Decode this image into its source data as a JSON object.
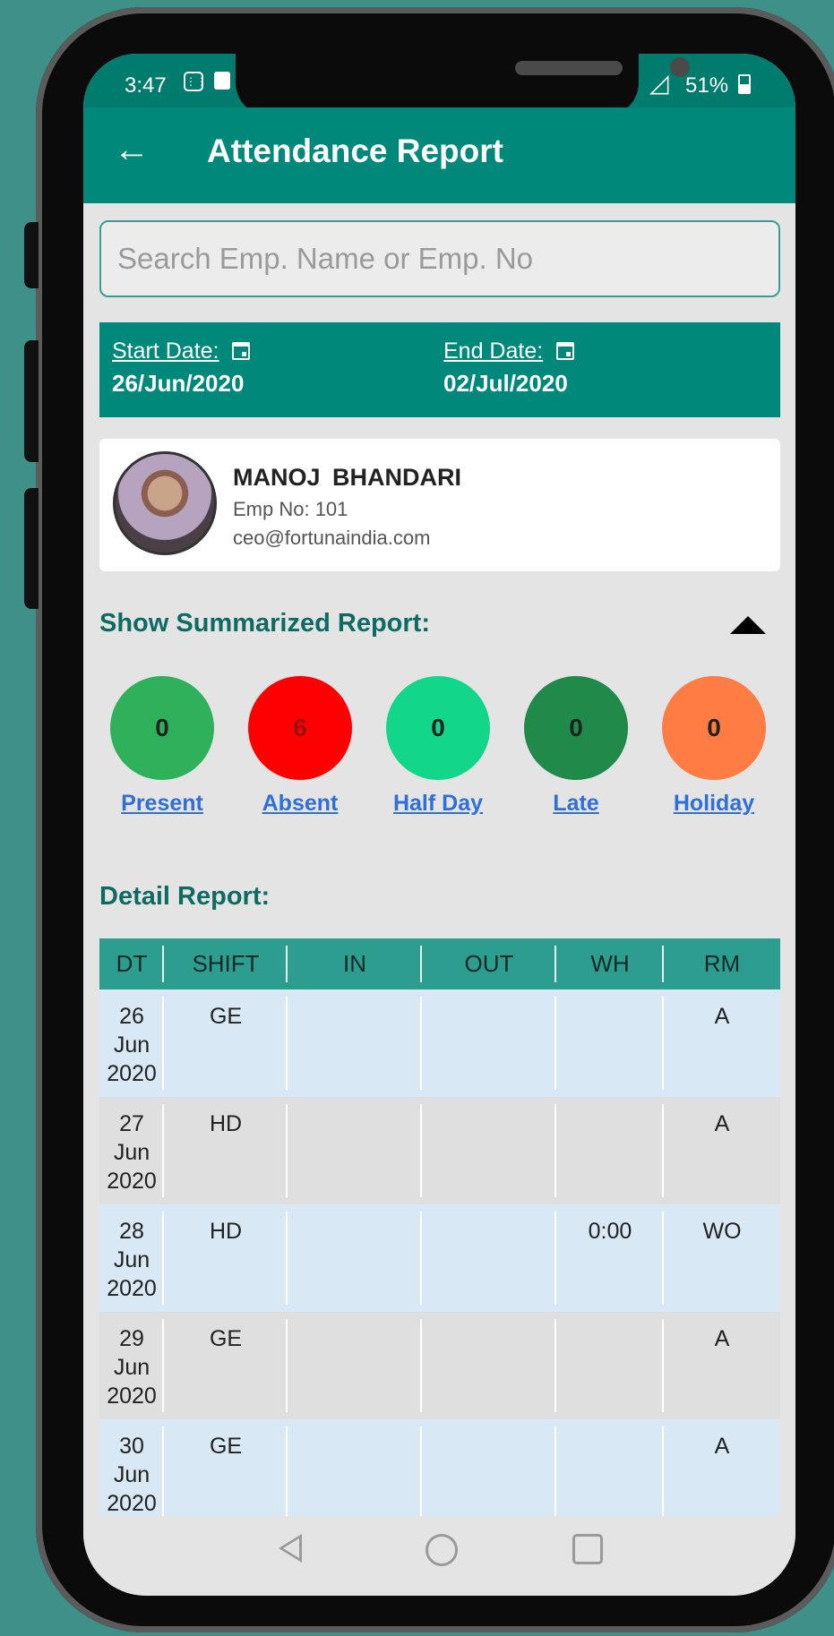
{
  "status": {
    "time": "3:47",
    "battery": "51%",
    "signal_icon": "signal-icon"
  },
  "appbar": {
    "back_icon": "arrow-left-icon",
    "title": "Attendance Report"
  },
  "search": {
    "placeholder": "Search Emp. Name or Emp. No",
    "value": ""
  },
  "dates": {
    "start_label": "Start Date:",
    "start_value": "26/Jun/2020",
    "end_label": "End Date:",
    "end_value": "02/Jul/2020",
    "icon": "calendar-icon"
  },
  "employee": {
    "name": "MANOJ BHANDARI",
    "emp_no": "Emp No: 101",
    "email": "ceo@fortunaindia.com"
  },
  "summary": {
    "title": "Show Summarized Report:",
    "items": [
      {
        "count": "0",
        "label": "Present",
        "color": "#2fb15c",
        "text_color": "#222222"
      },
      {
        "count": "6",
        "label": "Absent",
        "color": "#ff0000",
        "text_color": "#9c1010"
      },
      {
        "count": "0",
        "label": "Half Day",
        "color": "#12d78a",
        "text_color": "#222222"
      },
      {
        "count": "0",
        "label": "Late",
        "color": "#1f8a4a",
        "text_color": "#222222"
      },
      {
        "count": "0",
        "label": "Holiday",
        "color": "#ff7c45",
        "text_color": "#222222"
      }
    ]
  },
  "detail": {
    "title": "Detail Report:",
    "columns": [
      "DT",
      "SHIFT",
      "IN",
      "OUT",
      "WH",
      "RM"
    ],
    "rows": [
      {
        "dt": [
          "26",
          "Jun",
          "2020"
        ],
        "shift": "GE",
        "in": "",
        "out": "",
        "wh": "",
        "rm": "A"
      },
      {
        "dt": [
          "27",
          "Jun",
          "2020"
        ],
        "shift": "HD",
        "in": "",
        "out": "",
        "wh": "",
        "rm": "A"
      },
      {
        "dt": [
          "28",
          "Jun",
          "2020"
        ],
        "shift": "HD",
        "in": "",
        "out": "",
        "wh": "0:00",
        "rm": "WO"
      },
      {
        "dt": [
          "29",
          "Jun",
          "2020"
        ],
        "shift": "GE",
        "in": "",
        "out": "",
        "wh": "",
        "rm": "A"
      },
      {
        "dt": [
          "30",
          "Jun",
          "2020"
        ],
        "shift": "GE",
        "in": "",
        "out": "",
        "wh": "",
        "rm": "A"
      }
    ]
  },
  "colors": {
    "primary": "#00897b",
    "accent_text": "#0d6b62",
    "link": "#2f6fd6"
  }
}
